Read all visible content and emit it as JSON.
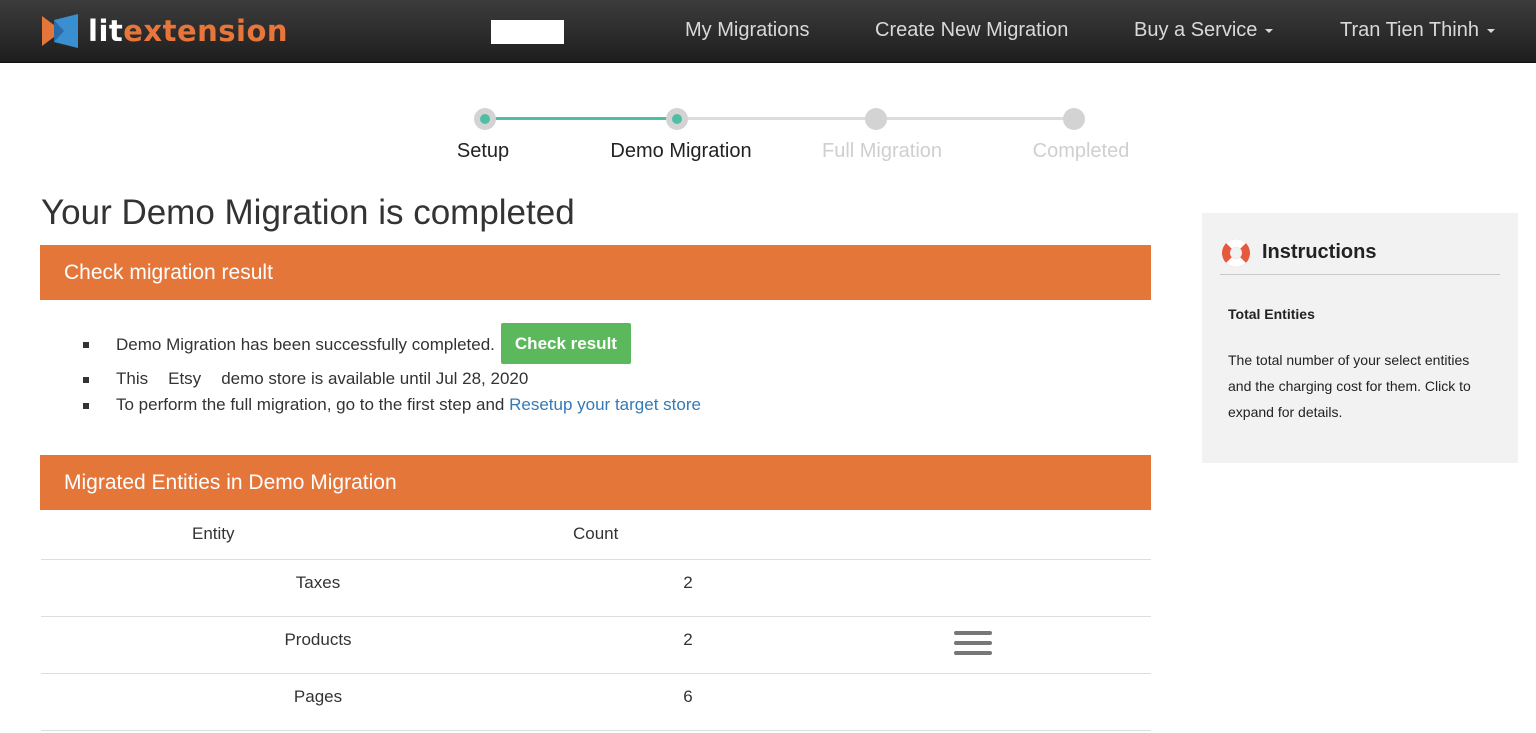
{
  "brand": {
    "logo_part1": "lit",
    "logo_part2": "extension",
    "color_orange": "#e5763a",
    "color_teal": "#4ebfa2",
    "color_green": "#5cb85c",
    "color_link": "#337ab7"
  },
  "nav": {
    "items": [
      {
        "label": "My Migrations"
      },
      {
        "label": "Create New Migration"
      },
      {
        "label": "Buy a Service",
        "dropdown": true
      },
      {
        "label": "Tran Tien Thinh",
        "dropdown": true
      }
    ]
  },
  "stepper": {
    "steps": [
      {
        "label": "Setup",
        "status": "done"
      },
      {
        "label": "Demo Migration",
        "status": "done"
      },
      {
        "label": "Full Migration",
        "status": "pending"
      },
      {
        "label": "Completed",
        "status": "pending"
      }
    ]
  },
  "main": {
    "title": "Your Demo Migration is completed",
    "result_panel": {
      "heading": "Check migration result",
      "bullet1": "Demo Migration has been successfully completed.",
      "check_button": "Check result",
      "bullet2_prefix": "This",
      "bullet2_platform": "Etsy",
      "bullet2_suffix": "demo store is available until Jul 28, 2020",
      "bullet3_prefix": "To perform the full migration, go to the first step and",
      "bullet3_link": "Resetup your target store"
    },
    "entities_panel": {
      "heading": "Migrated Entities in Demo Migration",
      "columns": [
        "Entity",
        "Count"
      ],
      "rows": [
        {
          "entity": "Taxes",
          "count": "2"
        },
        {
          "entity": "Products",
          "count": "2",
          "menu_icon": "hamburger-menu-icon"
        },
        {
          "entity": "Pages",
          "count": "6"
        }
      ]
    }
  },
  "sidebar": {
    "icon": "lifebuoy-icon",
    "title": "Instructions",
    "subtitle": "Total Entities",
    "text": "The total number of your select entities and the charging cost for them. Click to expand for details."
  }
}
